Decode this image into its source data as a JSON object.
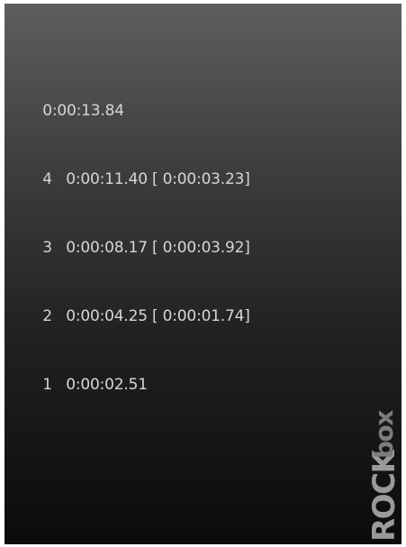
{
  "stopwatch": {
    "total_time": "0:00:13.84",
    "laps": [
      {
        "number": "4",
        "time": "0:00:11.40",
        "split": "[ 0:00:03.23]"
      },
      {
        "number": "3",
        "time": "0:00:08.17",
        "split": "[ 0:00:03.92]"
      },
      {
        "number": "2",
        "time": "0:00:04.25",
        "split": "[ 0:00:01.74]"
      },
      {
        "number": "1",
        "time": "0:00:02.51",
        "split": ""
      }
    ]
  },
  "branding": {
    "logo_text": "ROCKbox"
  },
  "colors": {
    "text": "#d6d6d6",
    "background_top": "#5e5e5e",
    "background_bottom": "#0b0b0b"
  }
}
